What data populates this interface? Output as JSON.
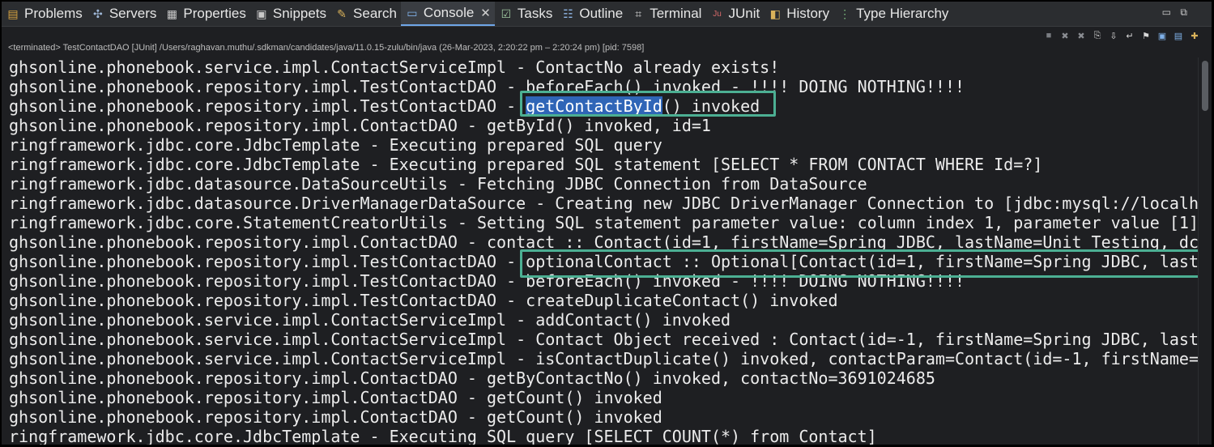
{
  "tabs": [
    {
      "label": "Problems",
      "icon": "problems-icon"
    },
    {
      "label": "Servers",
      "icon": "servers-icon"
    },
    {
      "label": "Properties",
      "icon": "properties-icon"
    },
    {
      "label": "Snippets",
      "icon": "snippets-icon"
    },
    {
      "label": "Search",
      "icon": "search-icon"
    },
    {
      "label": "Console",
      "icon": "console-icon",
      "active": true
    },
    {
      "label": "Tasks",
      "icon": "tasks-icon"
    },
    {
      "label": "Outline",
      "icon": "outline-icon"
    },
    {
      "label": "Terminal",
      "icon": "terminal-icon"
    },
    {
      "label": "JUnit",
      "icon": "junit-icon"
    },
    {
      "label": "History",
      "icon": "history-icon"
    },
    {
      "label": "Type Hierarchy",
      "icon": "type-hierarchy-icon"
    }
  ],
  "status": "<terminated> TestContactDAO [JUnit] /Users/raghavan.muthu/.sdkman/candidates/java/11.0.15-zulu/bin/java  (26-Mar-2023, 2:20:22 pm – 2:20:24 pm) [pid: 7598]",
  "console_lines": [
    {
      "pre": "ghsonline.phonebook.service.impl.ContactServiceImpl - ContactNo already exists!"
    },
    {
      "pre": "ghsonline.phonebook.repository.impl.TestContactDAO - beforeEach() invoked - !!!! DOING NOTHING!!!!"
    },
    {
      "pre": "ghsonline.phonebook.repository.impl.TestContactDAO - ",
      "hl": "getContactById",
      "post": "() invoked"
    },
    {
      "pre": "ghsonline.phonebook.repository.impl.ContactDAO - getById() invoked, id=1"
    },
    {
      "pre": "ringframework.jdbc.core.JdbcTemplate - Executing prepared SQL query"
    },
    {
      "pre": "ringframework.jdbc.core.JdbcTemplate - Executing prepared SQL statement [SELECT * FROM CONTACT WHERE Id=?]"
    },
    {
      "pre": "ringframework.jdbc.datasource.DataSourceUtils - Fetching JDBC Connection from DataSource"
    },
    {
      "pre": "ringframework.jdbc.datasource.DriverManagerDataSource - Creating new JDBC DriverManager Connection to [jdbc:mysql://localh"
    },
    {
      "pre": "ringframework.jdbc.core.StatementCreatorUtils - Setting SQL statement parameter value: column index 1, parameter value [1]"
    },
    {
      "pre": "ghsonline.phonebook.repository.impl.ContactDAO - contact :: Contact(id=1, firstName=Spring JDBC, lastName=Unit Testing, dc"
    },
    {
      "pre": "ghsonline.phonebook.repository.impl.TestContactDAO - optionalContact :: Optional[Contact(id=1, firstName=Spring JDBC, last"
    },
    {
      "pre": "ghsonline.phonebook.repository.impl.TestContactDAO - beforeEach() invoked - !!!! DOING NOTHING!!!!"
    },
    {
      "pre": "ghsonline.phonebook.repository.impl.TestContactDAO - createDuplicateContact() invoked"
    },
    {
      "pre": "ghsonline.phonebook.service.impl.ContactServiceImpl - addContact() invoked"
    },
    {
      "pre": "ghsonline.phonebook.service.impl.ContactServiceImpl - Contact Object received : Contact(id=-1, firstName=Spring JDBC, last"
    },
    {
      "pre": "ghsonline.phonebook.service.impl.ContactServiceImpl - isContactDuplicate() invoked, contactParam=Contact(id=-1, firstName="
    },
    {
      "pre": "ghsonline.phonebook.repository.impl.ContactDAO - getByContactNo() invoked, contactNo=3691024685"
    },
    {
      "pre": "ghsonline.phonebook.repository.impl.ContactDAO - getCount() invoked"
    },
    {
      "pre": "ghsonline.phonebook.repository.impl.ContactDAO - getCount() invoked"
    },
    {
      "pre": "ringframework.jdbc.core.JdbcTemplate - Executing SQL query [SELECT COUNT(*) from Contact]"
    }
  ],
  "toolbar_icons": [
    "terminate-icon",
    "remove-launch-icon",
    "remove-all-icon",
    "copy-icon",
    "scroll-lock-icon",
    "word-wrap-icon",
    "pin-console-icon",
    "display-selected-icon",
    "open-console-icon",
    "new-console-icon"
  ],
  "accent": "#4caf93",
  "selection_color": "#2f65b7"
}
